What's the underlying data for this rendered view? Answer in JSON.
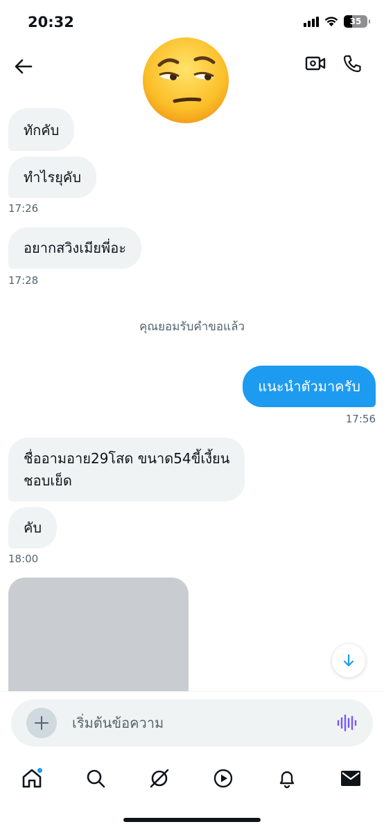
{
  "status_bar": {
    "time": "20:32",
    "battery": "35"
  },
  "messages": [
    {
      "text": "ทักคับ"
    },
    {
      "text": "ทำไรยุคับ"
    },
    {
      "text": "17:26"
    },
    {
      "text": "อยากสวิงเมียพี่อะ"
    },
    {
      "text": "17:28"
    },
    {
      "text": "คุณยอมรับคำขอแล้ว"
    },
    {
      "text": "แนะนำตัวมาครับ"
    },
    {
      "text": "17:56"
    },
    {
      "text": "ชื่ออามอาย29โสด ขนาด54ขี้เงี้ยน\nชอบเย็ด"
    },
    {
      "text": "คับ"
    },
    {
      "text": "18:00"
    }
  ],
  "composer": {
    "placeholder": "เริ่มต้นข้อความ"
  },
  "colors": {
    "accent": "#1d9bf0",
    "incoming_bubble": "#eff3f4",
    "voice_icon": "#7856ff"
  },
  "icons": [
    "back-arrow-icon",
    "video-call-icon",
    "phone-icon",
    "avatar-emoji",
    "chevron-down-icon",
    "plus-icon",
    "voice-waveform-icon",
    "home-icon",
    "search-icon",
    "grok-icon",
    "video-play-icon",
    "bell-icon",
    "mail-icon"
  ]
}
